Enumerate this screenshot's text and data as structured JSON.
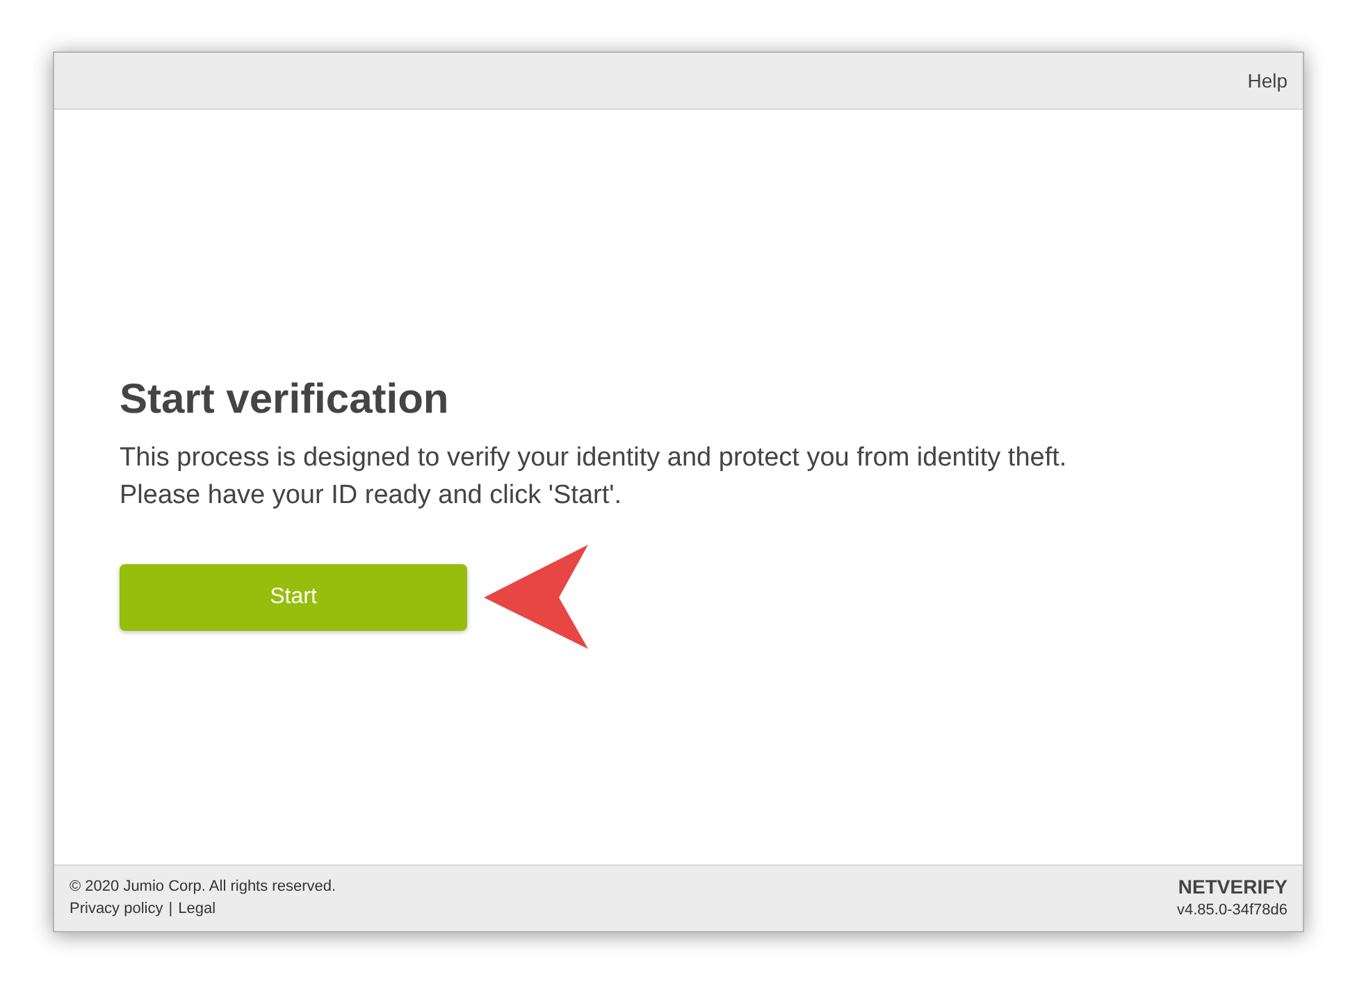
{
  "header": {
    "help_link": "Help"
  },
  "main": {
    "title": "Start verification",
    "description_lines": [
      "This process is designed to verify your identity and protect you from identity theft.",
      "Please have your ID ready and click 'Start'."
    ],
    "start_button": "Start"
  },
  "footer": {
    "copyright": "© 2020 Jumio Corp. All rights reserved.",
    "links": [
      "Privacy policy",
      "Legal"
    ],
    "separator": "|",
    "brand": "NETVERIFY",
    "version": "v4.85.0-34f78d6"
  }
}
